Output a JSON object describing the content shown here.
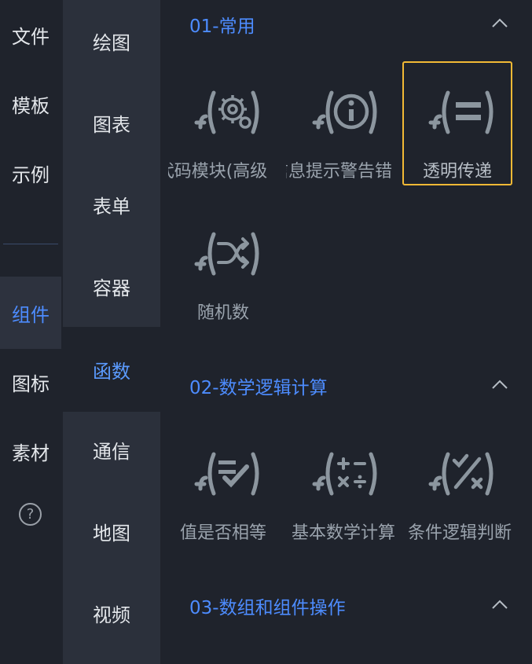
{
  "primary_nav": {
    "items": [
      {
        "label": "文件",
        "active": false
      },
      {
        "label": "模板",
        "active": false
      },
      {
        "label": "示例",
        "active": false
      },
      {
        "label": "组件",
        "active": true
      },
      {
        "label": "图标",
        "active": false
      },
      {
        "label": "素材",
        "active": false
      }
    ],
    "help_icon": "?"
  },
  "secondary_nav": {
    "items": [
      {
        "label": "绘图",
        "active": false
      },
      {
        "label": "图表",
        "active": false
      },
      {
        "label": "表单",
        "active": false
      },
      {
        "label": "容器",
        "active": false
      },
      {
        "label": "函数",
        "active": true
      },
      {
        "label": "通信",
        "active": false
      },
      {
        "label": "地图",
        "active": false
      },
      {
        "label": "视频",
        "active": false
      }
    ]
  },
  "sections": [
    {
      "title": "01-常用",
      "collapse_icon": "chevron-up-icon",
      "tiles": [
        {
          "label": "代码模块(高级",
          "icon": "function-gear-icon",
          "selected": false
        },
        {
          "label": "信息提示警告错",
          "icon": "function-info-icon",
          "selected": false
        },
        {
          "label": "透明传递",
          "icon": "function-equals-icon",
          "selected": true
        },
        {
          "label": "随机数",
          "icon": "function-shuffle-icon",
          "selected": false
        }
      ]
    },
    {
      "title": "02-数学逻辑计算",
      "collapse_icon": "chevron-up-icon",
      "tiles": [
        {
          "label": "值是否相等",
          "icon": "function-compare-icon",
          "selected": false
        },
        {
          "label": "基本数学计算",
          "icon": "function-arithmetic-icon",
          "selected": false
        },
        {
          "label": "条件逻辑判断",
          "icon": "function-logic-icon",
          "selected": false
        }
      ]
    },
    {
      "title": "03-数组和组件操作",
      "collapse_icon": "chevron-up-icon",
      "tiles": []
    }
  ],
  "colors": {
    "accent": "#4d8cff",
    "selected_border": "#f2b935",
    "icon": "#8c969f"
  }
}
